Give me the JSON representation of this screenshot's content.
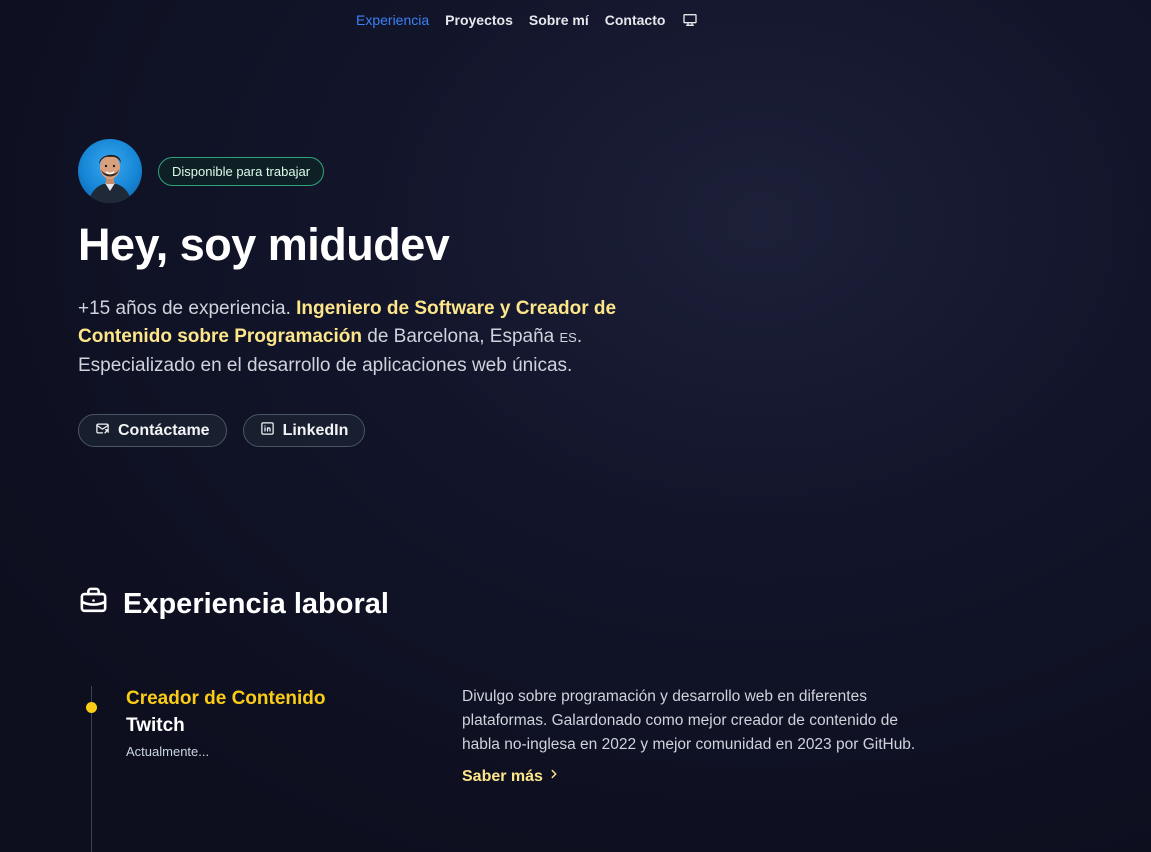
{
  "nav": {
    "items": [
      {
        "label": "Experiencia",
        "active": true
      },
      {
        "label": "Proyectos",
        "active": false
      },
      {
        "label": "Sobre mí",
        "active": false
      },
      {
        "label": "Contacto",
        "active": false
      }
    ],
    "theme_icon": "monitor-icon"
  },
  "hero": {
    "badge": "Disponible para trabajar",
    "title": "Hey, soy midudev",
    "intro": {
      "part1": "+15 años de experiencia. ",
      "highlight": "Ingeniero de Software y Creador de Contenido sobre Programación",
      "part2": " de Barcelona, España ",
      "flag": "ES",
      "part3": ". Especializado en el desarrollo de aplicaciones web únicas."
    },
    "buttons": {
      "contact": "Contáctame",
      "linkedin": "LinkedIn"
    }
  },
  "experience": {
    "title": "Experiencia laboral",
    "jobs": [
      {
        "role": "Creador de Contenido",
        "company": "Twitch",
        "date": "Actualmente...",
        "description": "Divulgo sobre programación y desarrollo web en diferentes plataformas. Galardonado como mejor creador de contenido de habla no-inglesa en 2022 y mejor comunidad en 2023 por GitHub.",
        "more": "Saber más"
      }
    ]
  },
  "colors": {
    "accent": "#3b82f6",
    "highlight": "#fde68a",
    "role": "#facc15",
    "badge_border": "#2fa37a",
    "background": "#12142a"
  }
}
